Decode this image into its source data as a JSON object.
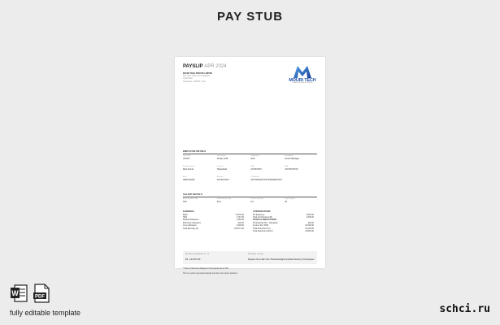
{
  "page": {
    "title": "PAY STUB",
    "footer_left": "fully editable template",
    "footer_right": "schci.ru",
    "icons": [
      "word-file-icon",
      "pdf-file-icon"
    ],
    "pdf_label": "PDF"
  },
  "document": {
    "title": "PAYSLIP",
    "month": "APR 2024",
    "company": {
      "name": "MOURI TECH",
      "tagline": "TRANSFORMING BUSINESS",
      "address": [
        "MOURI TECH PRIVATE LIMITED",
        "Plot 46-D, Hitec City, Madhapur",
        "Hyderabad",
        "Telangana - 500081, India"
      ]
    },
    "employee_section": {
      "heading": "EMPLOYEE DETAILS",
      "rows": [
        [
          {
            "label": "Emp Code",
            "value": "XXXXX"
          },
          {
            "label": "Date Joined",
            "value": "18 Apr 2019"
          },
          {
            "label": "Department",
            "value": "SAP"
          },
          {
            "label": "Designation",
            "value": "Senior Manager"
          }
        ],
        [
          {
            "label": "Employee Name",
            "value": "Ravi Kumar"
          },
          {
            "label": "Location",
            "value": "Hyderabad"
          },
          {
            "label": "PAN",
            "value": "AXXXXXXX"
          },
          {
            "label": "UAN",
            "value": "1XXXXXXXXX"
          }
        ],
        [
          {
            "label": "Bank",
            "value": "HDFC BANK"
          },
          {
            "label": "Account",
            "value": "XXXXXXXXX"
          },
          {
            "label": "PF Number",
            "value": "APHYD00XXXXXXXX00000XXXX"
          },
          {
            "label": "",
            "value": ""
          }
        ]
      ]
    },
    "salary_section": {
      "heading": "SALARY DETAILS",
      "row": [
        {
          "label": "Actual Payable Days",
          "value": "30.0"
        },
        {
          "label": "Total Working Days",
          "value": "30.0"
        },
        {
          "label": "Loss of Pay Days",
          "value": "0.0"
        },
        {
          "label": "Days Payable",
          "value": "30"
        }
      ]
    },
    "earnings": {
      "heading": "EARNINGS",
      "rows": [
        {
          "label": "Basic",
          "amount": "71,676.00"
        },
        {
          "label": "HRA",
          "amount": "7,167.00"
        },
        {
          "label": "Medical Allowance",
          "amount": "1,250.00"
        },
        {
          "label": "Education Allowance",
          "amount": "200.00"
        },
        {
          "label": "Conv Allowance",
          "amount": "1,600.00"
        },
        {
          "label": "Total Earnings (A)",
          "amount": "1,25,671.00"
        }
      ]
    },
    "deductions": {
      "heading": "CONTRIBUTIONS",
      "rows": [
        {
          "label": "PF Employee",
          "amount": "1,800.00"
        },
        {
          "label": "Total Contributions (B)",
          "amount": "1,800.00"
        }
      ],
      "tax_heading": "TAXES & DEDUCTIONS",
      "tax_rows": [
        {
          "label": "Professional Tax - Telangana",
          "amount": "200.00"
        },
        {
          "label": "Income Tax (TDS)",
          "amount": "20,000.00"
        },
        {
          "label": "Total Deductions (C)",
          "amount": "22,000.00"
        },
        {
          "label": "Total Deductions (B+C)",
          "amount": "23,800.00"
        }
      ]
    },
    "summary": {
      "label1": "Net Salary Payable (A - B - C)",
      "value1": "Rs. 1,01,871.00",
      "label2": "Net Salary in words",
      "value2": "Rupees One Lakh One Thousand Eight Hundred Seventy One Rupees"
    },
    "notes": [
      "**Note: All amounts displayed in this payslip are in INR",
      "This is a system generated payslip and does not require signature"
    ]
  }
}
